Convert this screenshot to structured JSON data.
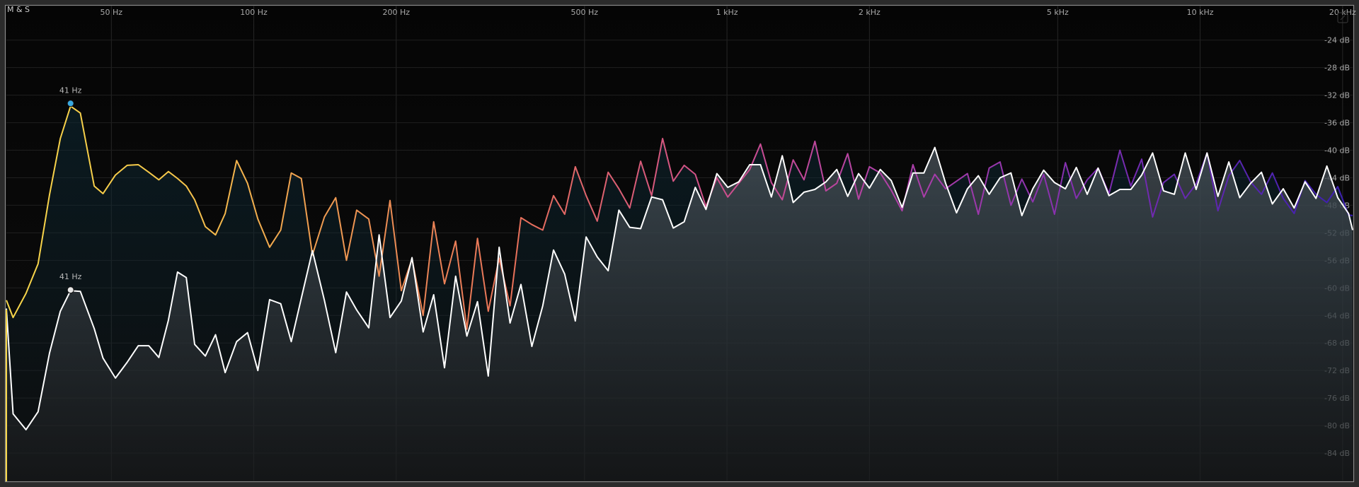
{
  "mode_label": "M & S",
  "colors": {
    "background": "#050505",
    "grid": "#2a2a2a",
    "mid_low": "#f7d64a",
    "mid_lowmid": "#f0a050",
    "mid_mid": "#e8705a",
    "mid_high": "#c8409a",
    "mid_air": "#3a1fb0",
    "side_trace": "#ffffff",
    "peak_mid": "#3aa8e0",
    "peak_side": "#e8e8e8"
  },
  "chart_data": {
    "type": "line",
    "x_scale": "log",
    "x_unit": "Hz",
    "xlim": [
      30,
      21000
    ],
    "ylim": [
      -88,
      -19
    ],
    "grid": true,
    "x_ticks": [
      {
        "value": 50,
        "label": "50 Hz"
      },
      {
        "value": 100,
        "label": "100 Hz"
      },
      {
        "value": 200,
        "label": "200 Hz"
      },
      {
        "value": 500,
        "label": "500 Hz"
      },
      {
        "value": 1000,
        "label": "1 kHz"
      },
      {
        "value": 2000,
        "label": "2 kHz"
      },
      {
        "value": 5000,
        "label": "5 kHz"
      },
      {
        "value": 10000,
        "label": "10 kHz"
      },
      {
        "value": 20000,
        "label": "20 kHz"
      }
    ],
    "y_ticks": [
      {
        "value": -24,
        "label": "-24 dB"
      },
      {
        "value": -28,
        "label": "-28 dB"
      },
      {
        "value": -32,
        "label": "-32 dB"
      },
      {
        "value": -36,
        "label": "-36 dB"
      },
      {
        "value": -40,
        "label": "-40 dB"
      },
      {
        "value": -44,
        "label": "-44 dB"
      },
      {
        "value": -48,
        "label": "-48 dB"
      },
      {
        "value": -52,
        "label": "-52 dB"
      },
      {
        "value": -56,
        "label": "-56 dB"
      },
      {
        "value": -60,
        "label": "-60 dB"
      },
      {
        "value": -64,
        "label": "-64 dB"
      },
      {
        "value": -68,
        "label": "-68 dB"
      },
      {
        "value": -72,
        "label": "-72 dB"
      },
      {
        "value": -76,
        "label": "-76 dB"
      },
      {
        "value": -80,
        "label": "-80 dB"
      },
      {
        "value": -84,
        "label": "-84 dB"
      }
    ],
    "peaks": [
      {
        "trace": "mid",
        "x": 41,
        "y": -33.2,
        "label": "41 Hz"
      },
      {
        "trace": "side",
        "x": 41,
        "y": -60.3,
        "label": "41 Hz"
      }
    ],
    "series": [
      {
        "id": "mid",
        "x": [
          30,
          31,
          33,
          35,
          37,
          39,
          41,
          43,
          46,
          48,
          51,
          54,
          57,
          60,
          63,
          66,
          69,
          72,
          75,
          79,
          83,
          87,
          92,
          97,
          102,
          108,
          114,
          120,
          126,
          133,
          141,
          149,
          157,
          165,
          175,
          184,
          194,
          205,
          216,
          228,
          240,
          253,
          267,
          282,
          297,
          313,
          330,
          348,
          367,
          387,
          408,
          430,
          454,
          478,
          504,
          532,
          561,
          591,
          623,
          657,
          693,
          731,
          770,
          812,
          857,
          903,
          952,
          1004,
          1059,
          1117,
          1177,
          1241,
          1309,
          1380,
          1455,
          1534,
          1618,
          1706,
          1799,
          1897,
          2000,
          2109,
          2224,
          2345,
          2472,
          2607,
          2749,
          2898,
          3056,
          3222,
          3398,
          3582,
          3777,
          3983,
          4200,
          4428,
          4669,
          4923,
          5191,
          5474,
          5772,
          6086,
          6417,
          6767,
          7135,
          7523,
          7933,
          8365,
          8820,
          9300,
          9806,
          10340,
          10903,
          11497,
          12122,
          12782,
          13478,
          14212,
          14985,
          15801,
          16661,
          17568,
          18524,
          19532,
          20595,
          21000
        ],
        "y": [
          -61.8,
          -64.3,
          -60.8,
          -56.5,
          -46.5,
          -38.3,
          -33.6,
          -34.6,
          -45.2,
          -46.3,
          -43.6,
          -42.2,
          -42.1,
          -43.2,
          -44.3,
          -43.1,
          -44.1,
          -45.2,
          -47.2,
          -51.1,
          -52.3,
          -49.2,
          -41.5,
          -44.8,
          -50.0,
          -54.1,
          -51.6,
          -43.3,
          -44.1,
          -55.2,
          -49.7,
          -46.9,
          -56.0,
          -48.7,
          -50.0,
          -58.3,
          -47.3,
          -60.4,
          -55.8,
          -64.0,
          -50.4,
          -59.4,
          -53.2,
          -66.0,
          -52.8,
          -63.4,
          -55.7,
          -62.6,
          -49.8,
          -50.8,
          -51.6,
          -46.6,
          -49.3,
          -42.4,
          -46.6,
          -50.3,
          -43.2,
          -45.6,
          -48.4,
          -41.6,
          -46.6,
          -38.3,
          -44.5,
          -42.2,
          -43.5,
          -48.2,
          -44.0,
          -46.8,
          -44.8,
          -42.8,
          -39.1,
          -44.7,
          -47.2,
          -41.4,
          -44.3,
          -38.7,
          -45.9,
          -44.8,
          -40.5,
          -47.1,
          -42.4,
          -43.3,
          -45.8,
          -48.8,
          -42.1,
          -46.8,
          -43.5,
          -45.6,
          -44.5,
          -43.4,
          -49.3,
          -42.6,
          -41.7,
          -48.0,
          -44.2,
          -47.5,
          -43.5,
          -49.3,
          -41.8,
          -47.0,
          -44.3,
          -42.6,
          -46.3,
          -40.0,
          -45.2,
          -41.3,
          -49.7,
          -44.7,
          -43.5,
          -47.0,
          -44.9,
          -40.4,
          -48.8,
          -43.7,
          -41.5,
          -44.6,
          -46.4,
          -43.3,
          -47.0,
          -49.2,
          -44.4,
          -46.4,
          -47.6,
          -45.3,
          -49.4,
          -49.5
        ]
      },
      {
        "id": "side",
        "x": [
          30,
          31,
          33,
          35,
          37,
          39,
          41,
          43,
          46,
          48,
          51,
          54,
          57,
          60,
          63,
          66,
          69,
          72,
          75,
          79,
          83,
          87,
          92,
          97,
          102,
          108,
          114,
          120,
          126,
          133,
          141,
          149,
          157,
          165,
          175,
          184,
          194,
          205,
          216,
          228,
          240,
          253,
          267,
          282,
          297,
          313,
          330,
          348,
          367,
          387,
          408,
          430,
          454,
          478,
          504,
          532,
          561,
          591,
          623,
          657,
          693,
          731,
          770,
          812,
          857,
          903,
          952,
          1004,
          1059,
          1117,
          1177,
          1241,
          1309,
          1380,
          1455,
          1534,
          1618,
          1706,
          1799,
          1897,
          2000,
          2109,
          2224,
          2345,
          2472,
          2607,
          2749,
          2898,
          3056,
          3222,
          3398,
          3582,
          3777,
          3983,
          4200,
          4428,
          4669,
          4923,
          5191,
          5474,
          5772,
          6086,
          6417,
          6767,
          7135,
          7523,
          7933,
          8365,
          8820,
          9300,
          9806,
          10340,
          10903,
          11497,
          12122,
          12782,
          13478,
          14212,
          14985,
          15801,
          16661,
          17568,
          18524,
          19532,
          20595,
          21000
        ],
        "y": [
          -63.0,
          -78.3,
          -80.6,
          -78.0,
          -69.5,
          -63.4,
          -60.4,
          -60.5,
          -65.9,
          -70.2,
          -73.1,
          -70.8,
          -68.4,
          -68.4,
          -70.1,
          -64.7,
          -57.7,
          -58.5,
          -68.2,
          -69.9,
          -66.8,
          -72.3,
          -67.8,
          -66.5,
          -72.0,
          -61.7,
          -62.3,
          -67.8,
          -61.5,
          -54.6,
          -61.8,
          -69.4,
          -60.6,
          -63.2,
          -65.8,
          -52.3,
          -64.3,
          -61.9,
          -55.6,
          -66.4,
          -61.0,
          -71.6,
          -58.3,
          -67.0,
          -62.0,
          -72.8,
          -54.1,
          -65.1,
          -59.5,
          -68.5,
          -62.6,
          -54.5,
          -58.0,
          -64.8,
          -52.6,
          -55.5,
          -57.5,
          -48.7,
          -51.2,
          -51.4,
          -46.8,
          -47.2,
          -51.3,
          -50.4,
          -45.4,
          -48.6,
          -43.4,
          -45.4,
          -44.6,
          -42.1,
          -42.1,
          -46.8,
          -40.8,
          -47.6,
          -46.1,
          -45.7,
          -44.6,
          -42.8,
          -46.7,
          -43.4,
          -45.5,
          -42.8,
          -44.4,
          -48.3,
          -43.3,
          -43.3,
          -39.6,
          -44.8,
          -49.1,
          -45.6,
          -43.7,
          -46.4,
          -44.0,
          -43.3,
          -49.5,
          -45.6,
          -42.9,
          -44.7,
          -45.6,
          -42.5,
          -46.4,
          -42.6,
          -46.6,
          -45.7,
          -45.7,
          -43.6,
          -40.4,
          -45.9,
          -46.4,
          -40.4,
          -45.7,
          -40.4,
          -46.7,
          -41.7,
          -46.9,
          -44.8,
          -43.2,
          -47.8,
          -45.6,
          -48.4,
          -44.6,
          -47.0,
          -42.3,
          -46.9,
          -49.2,
          -51.6
        ]
      }
    ]
  }
}
